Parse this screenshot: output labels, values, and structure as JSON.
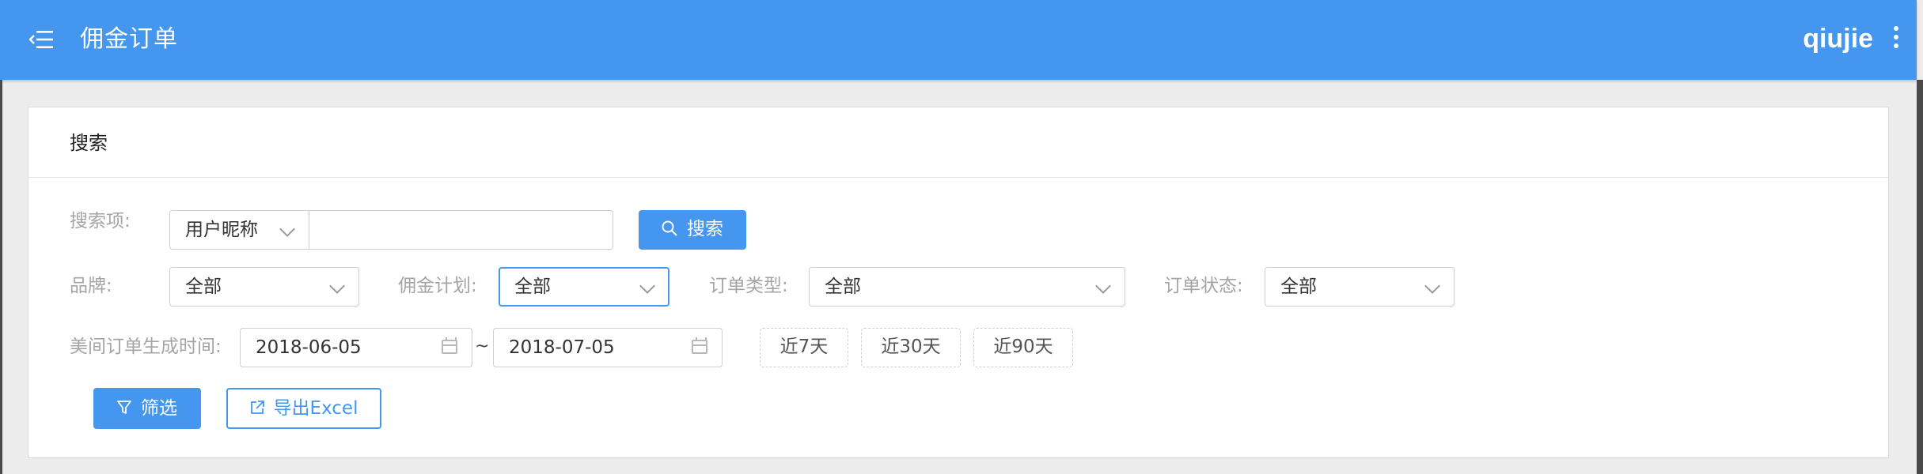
{
  "header": {
    "title": "佣金订单",
    "username": "qiujie"
  },
  "search_panel": {
    "title": "搜索",
    "search_item_label": "搜索项:",
    "search_field_select": "用户昵称",
    "search_input_value": "",
    "search_button": "搜索",
    "brand_label": "品牌:",
    "brand_value": "全部",
    "commission_plan_label": "佣金计划:",
    "commission_plan_value": "全部",
    "order_type_label": "订单类型:",
    "order_type_value": "全部",
    "order_status_label": "订单状态:",
    "order_status_value": "全部",
    "order_time_label": "美间订单生成时间:",
    "date_from": "2018-06-05",
    "date_separator": "~",
    "date_to": "2018-07-05",
    "quick_ranges": [
      "近7天",
      "近30天",
      "近90天"
    ],
    "filter_button": "筛选",
    "export_button": "导出Excel"
  },
  "colors": {
    "primary": "#4496ee",
    "header_bg": "#4496ee"
  }
}
